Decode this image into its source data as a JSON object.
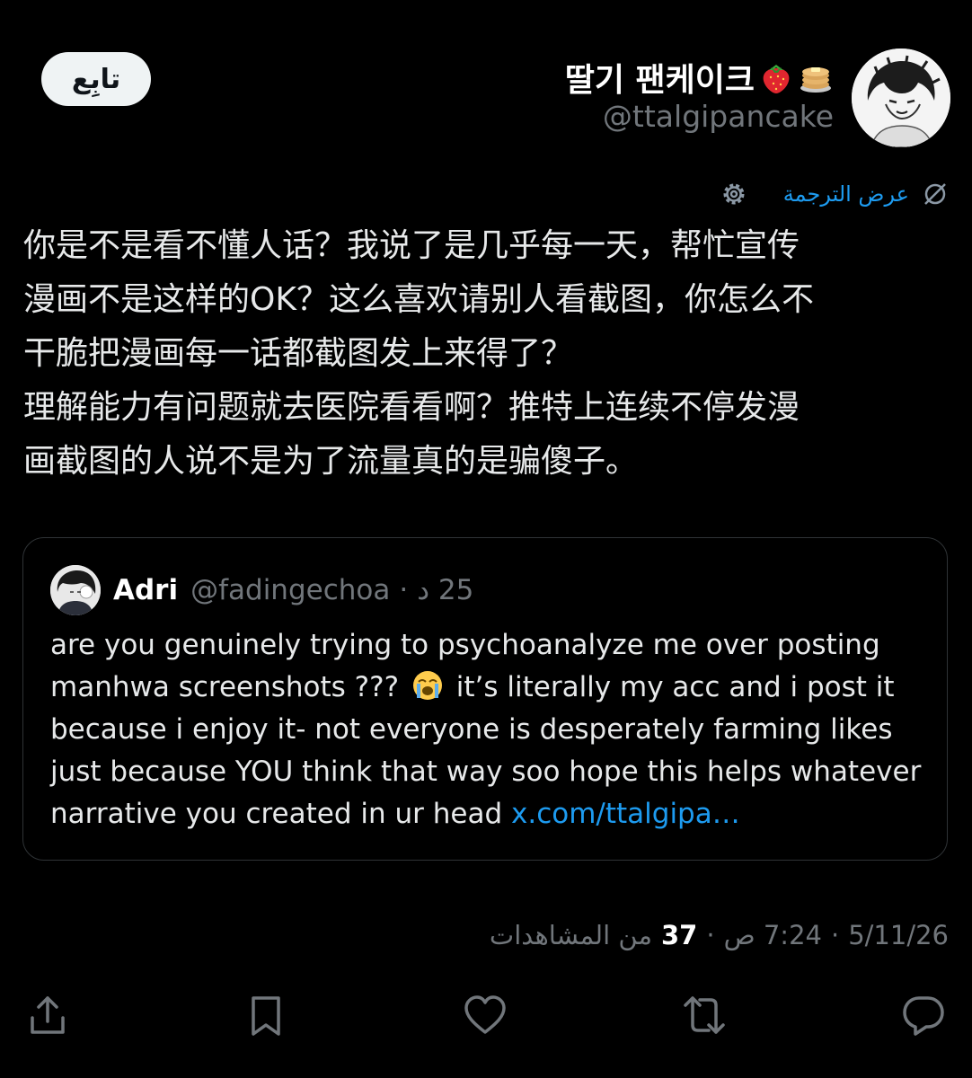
{
  "header": {
    "follow_label": "تابِع",
    "display_name": "딸기 팬케이크",
    "display_name_emojis": [
      "strawberry-emoji",
      "pancakes-emoji"
    ],
    "handle": "@ttalgipancake"
  },
  "translate": {
    "label": "عرض الترجمة"
  },
  "post": {
    "text": "你是不是看不懂人话？我说了是几乎每一天，帮忙宣传\n漫画不是这样的OK？这么喜欢请别人看截图，你怎么不\n干脆把漫画每一话都截图发上来得了？\n理解能力有问题就去医院看看啊？推特上连续不停发漫\n画截图的人说不是为了流量真的是骗傻子。"
  },
  "quote": {
    "name": "Adri",
    "handle": "@fadingechoa",
    "dot": "·",
    "time": "25 د",
    "text_before_emoji": "are you genuinely trying to psychoanalyze me over posting manhwa screenshots ???",
    "text_after_emoji": "it’s literally my acc and i post it because i enjoy it- not everyone is desperately farming likes just because YOU think that way soo hope this helps whatever narrative you created in ur head",
    "link": "x.com/ttalgipa…"
  },
  "meta": {
    "date": "5/11/26",
    "time": "7:24 ص",
    "views_count": "37",
    "views_label": "من المشاهدات",
    "separator": "·"
  },
  "actions": [
    "share-icon",
    "bookmark-icon",
    "like-icon",
    "repost-icon",
    "reply-icon"
  ],
  "colors": {
    "background": "#000000",
    "text": "#e7e9ea",
    "secondary": "#71767b",
    "accent": "#1d9bf0",
    "border": "#2f3336"
  }
}
